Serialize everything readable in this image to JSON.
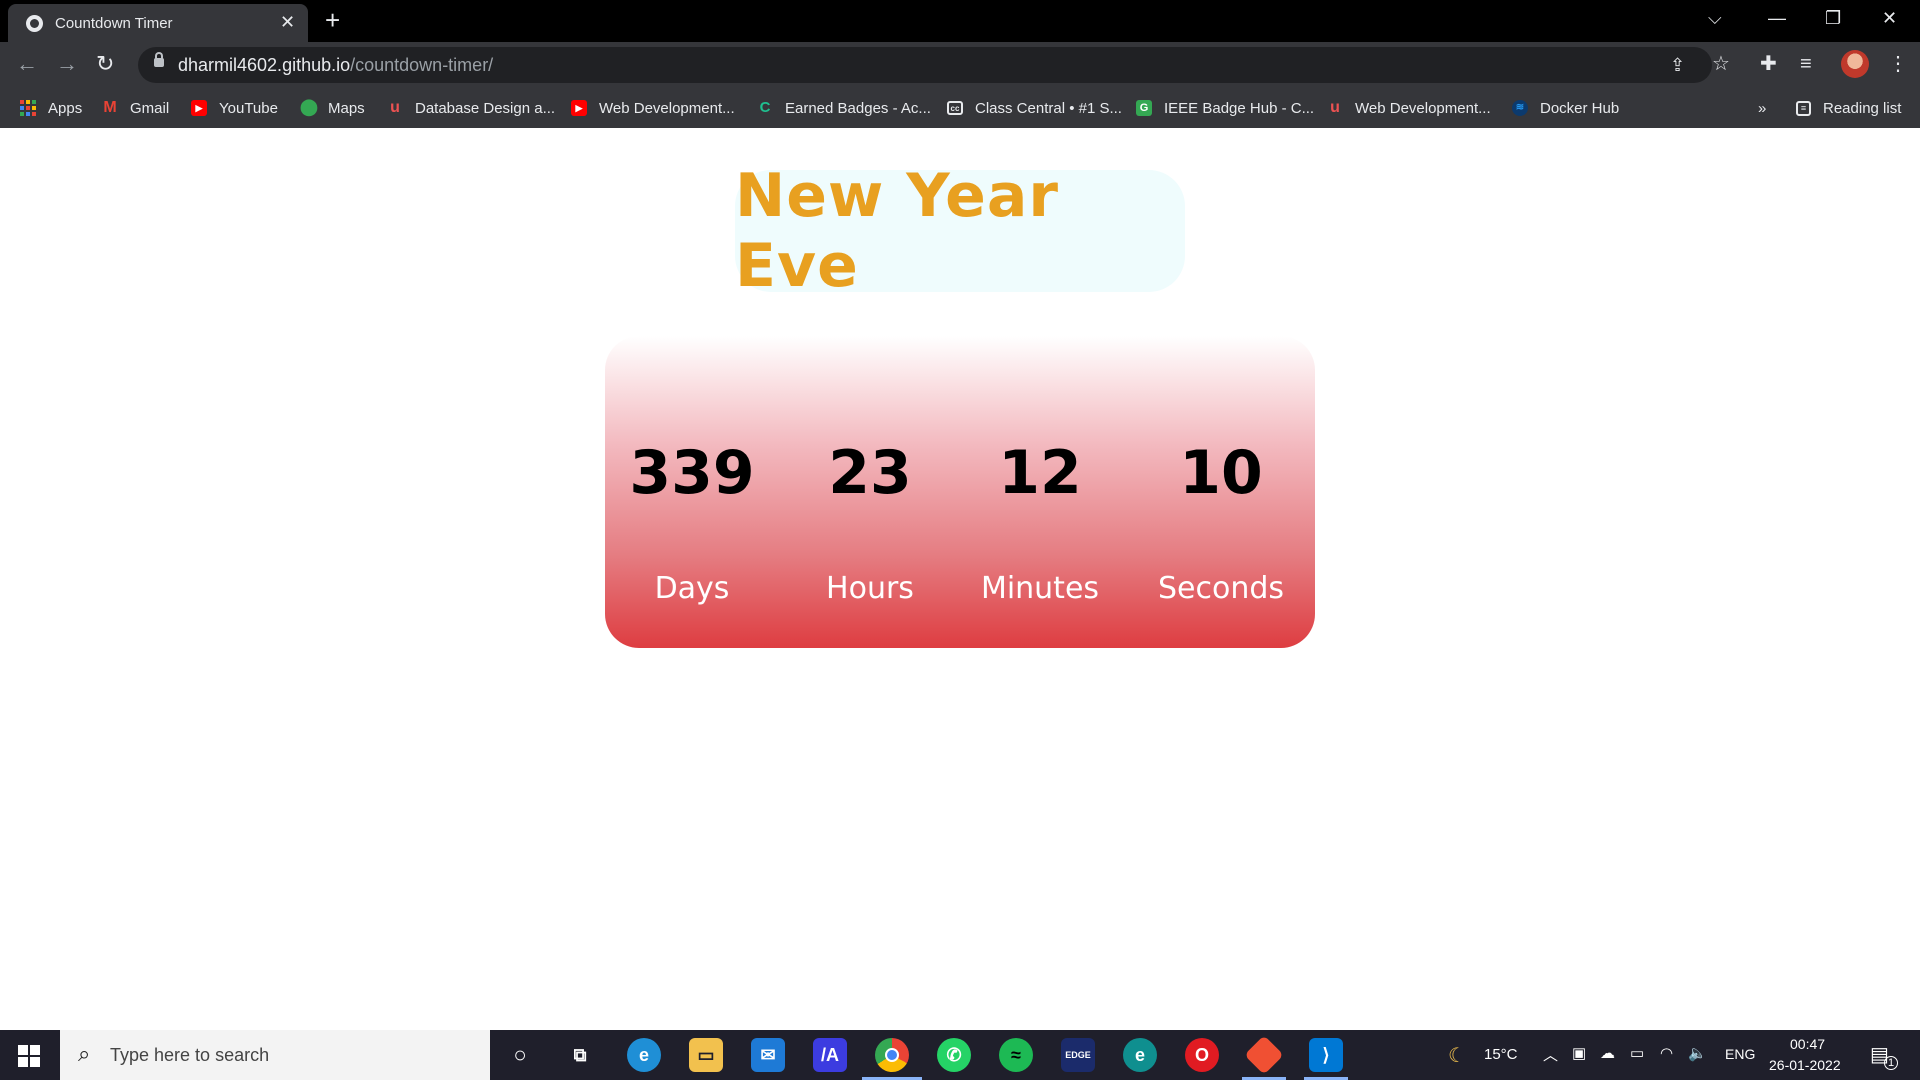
{
  "browser": {
    "tab_title": "Countdown Timer",
    "new_tab_symbol": "+",
    "url_host": "dharmil4602.github.io",
    "url_path": "/countdown-timer/"
  },
  "bookmarks": {
    "items": [
      {
        "label": "Apps",
        "icon": "apps-grid-icon"
      },
      {
        "label": "Gmail",
        "icon": "gmail-icon"
      },
      {
        "label": "YouTube",
        "icon": "youtube-icon"
      },
      {
        "label": "Maps",
        "icon": "maps-icon"
      },
      {
        "label": "Database Design a...",
        "icon": "udemy-icon"
      },
      {
        "label": "Web Development...",
        "icon": "youtube-icon"
      },
      {
        "label": "Earned Badges - Ac...",
        "icon": "credly-icon"
      },
      {
        "label": "Class Central • #1 S...",
        "icon": "classcentral-icon"
      },
      {
        "label": "IEEE Badge Hub - C...",
        "icon": "ieee-icon"
      },
      {
        "label": "Web Development...",
        "icon": "udemy-icon"
      },
      {
        "label": "Docker Hub",
        "icon": "docker-icon"
      }
    ],
    "overflow": "»",
    "reading_list": "Reading list"
  },
  "page": {
    "heading": "New Year Eve",
    "timer": [
      {
        "value": "339",
        "label": "Days"
      },
      {
        "value": "23",
        "label": "Hours"
      },
      {
        "value": "12",
        "label": "Minutes"
      },
      {
        "value": "10",
        "label": "Seconds"
      }
    ],
    "colors": {
      "heading": "#e8a020",
      "heading_bg": "#effcfd",
      "card_top": "#ffffff",
      "card_bottom": "#de3d41"
    }
  },
  "taskbar": {
    "search_placeholder": "Type here to search",
    "temperature": "15°C",
    "language": "ENG",
    "time": "00:47",
    "date": "26-01-2022",
    "notification_count": "1",
    "apps": [
      "cortana-icon",
      "task-view-icon",
      "edge-icon",
      "file-explorer-icon",
      "mail-icon",
      "visual-studio-icon",
      "chrome-icon",
      "whatsapp-icon",
      "spotify-icon",
      "stock-edge-icon",
      "edge-beta-icon",
      "opera-icon",
      "git-icon",
      "vscode-icon"
    ]
  }
}
